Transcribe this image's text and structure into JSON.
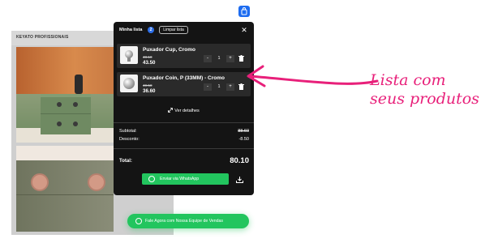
{
  "catalog": {
    "title": "KEYATO PROFISSIONAIS"
  },
  "cart": {
    "title": "Minha lista",
    "count": "2",
    "clear_label": "Limpar lista",
    "close_label": "✕",
    "items": [
      {
        "name": "Puxador Cup, Cromo",
        "old_price": "48.10",
        "price": "43.50",
        "qty": "1",
        "minus": "-",
        "plus": "+"
      },
      {
        "name": "Puxador Coin, P (33MM) - Cromo",
        "old_price": "40.50",
        "price": "36.60",
        "qty": "1",
        "minus": "-",
        "plus": "+"
      }
    ],
    "details_label": "Ver detalhes",
    "subtotal_label": "Subtotal:",
    "subtotal_value": "88.60",
    "discount_label": "Desconto:",
    "discount_value": "-8.50",
    "total_label": "Total:",
    "total_value": "80.10",
    "whatsapp_label": "Enviar via WhatsApp"
  },
  "contact_pill": {
    "label": "Fale Agora com Nossa Equipe de Vendas"
  },
  "annotation": {
    "line1": "Lista com",
    "line2": "seus produtos"
  },
  "icons": {
    "bag": "shopping-bag-icon",
    "close": "close-icon",
    "trash": "trash-icon",
    "expand": "expand-icon",
    "whatsapp": "whatsapp-icon",
    "download": "download-icon"
  },
  "colors": {
    "panel_bg": "#141414",
    "accent_blue": "#2d6fe8",
    "whatsapp_green": "#22c55e",
    "annotation_pink": "#e8207a"
  }
}
